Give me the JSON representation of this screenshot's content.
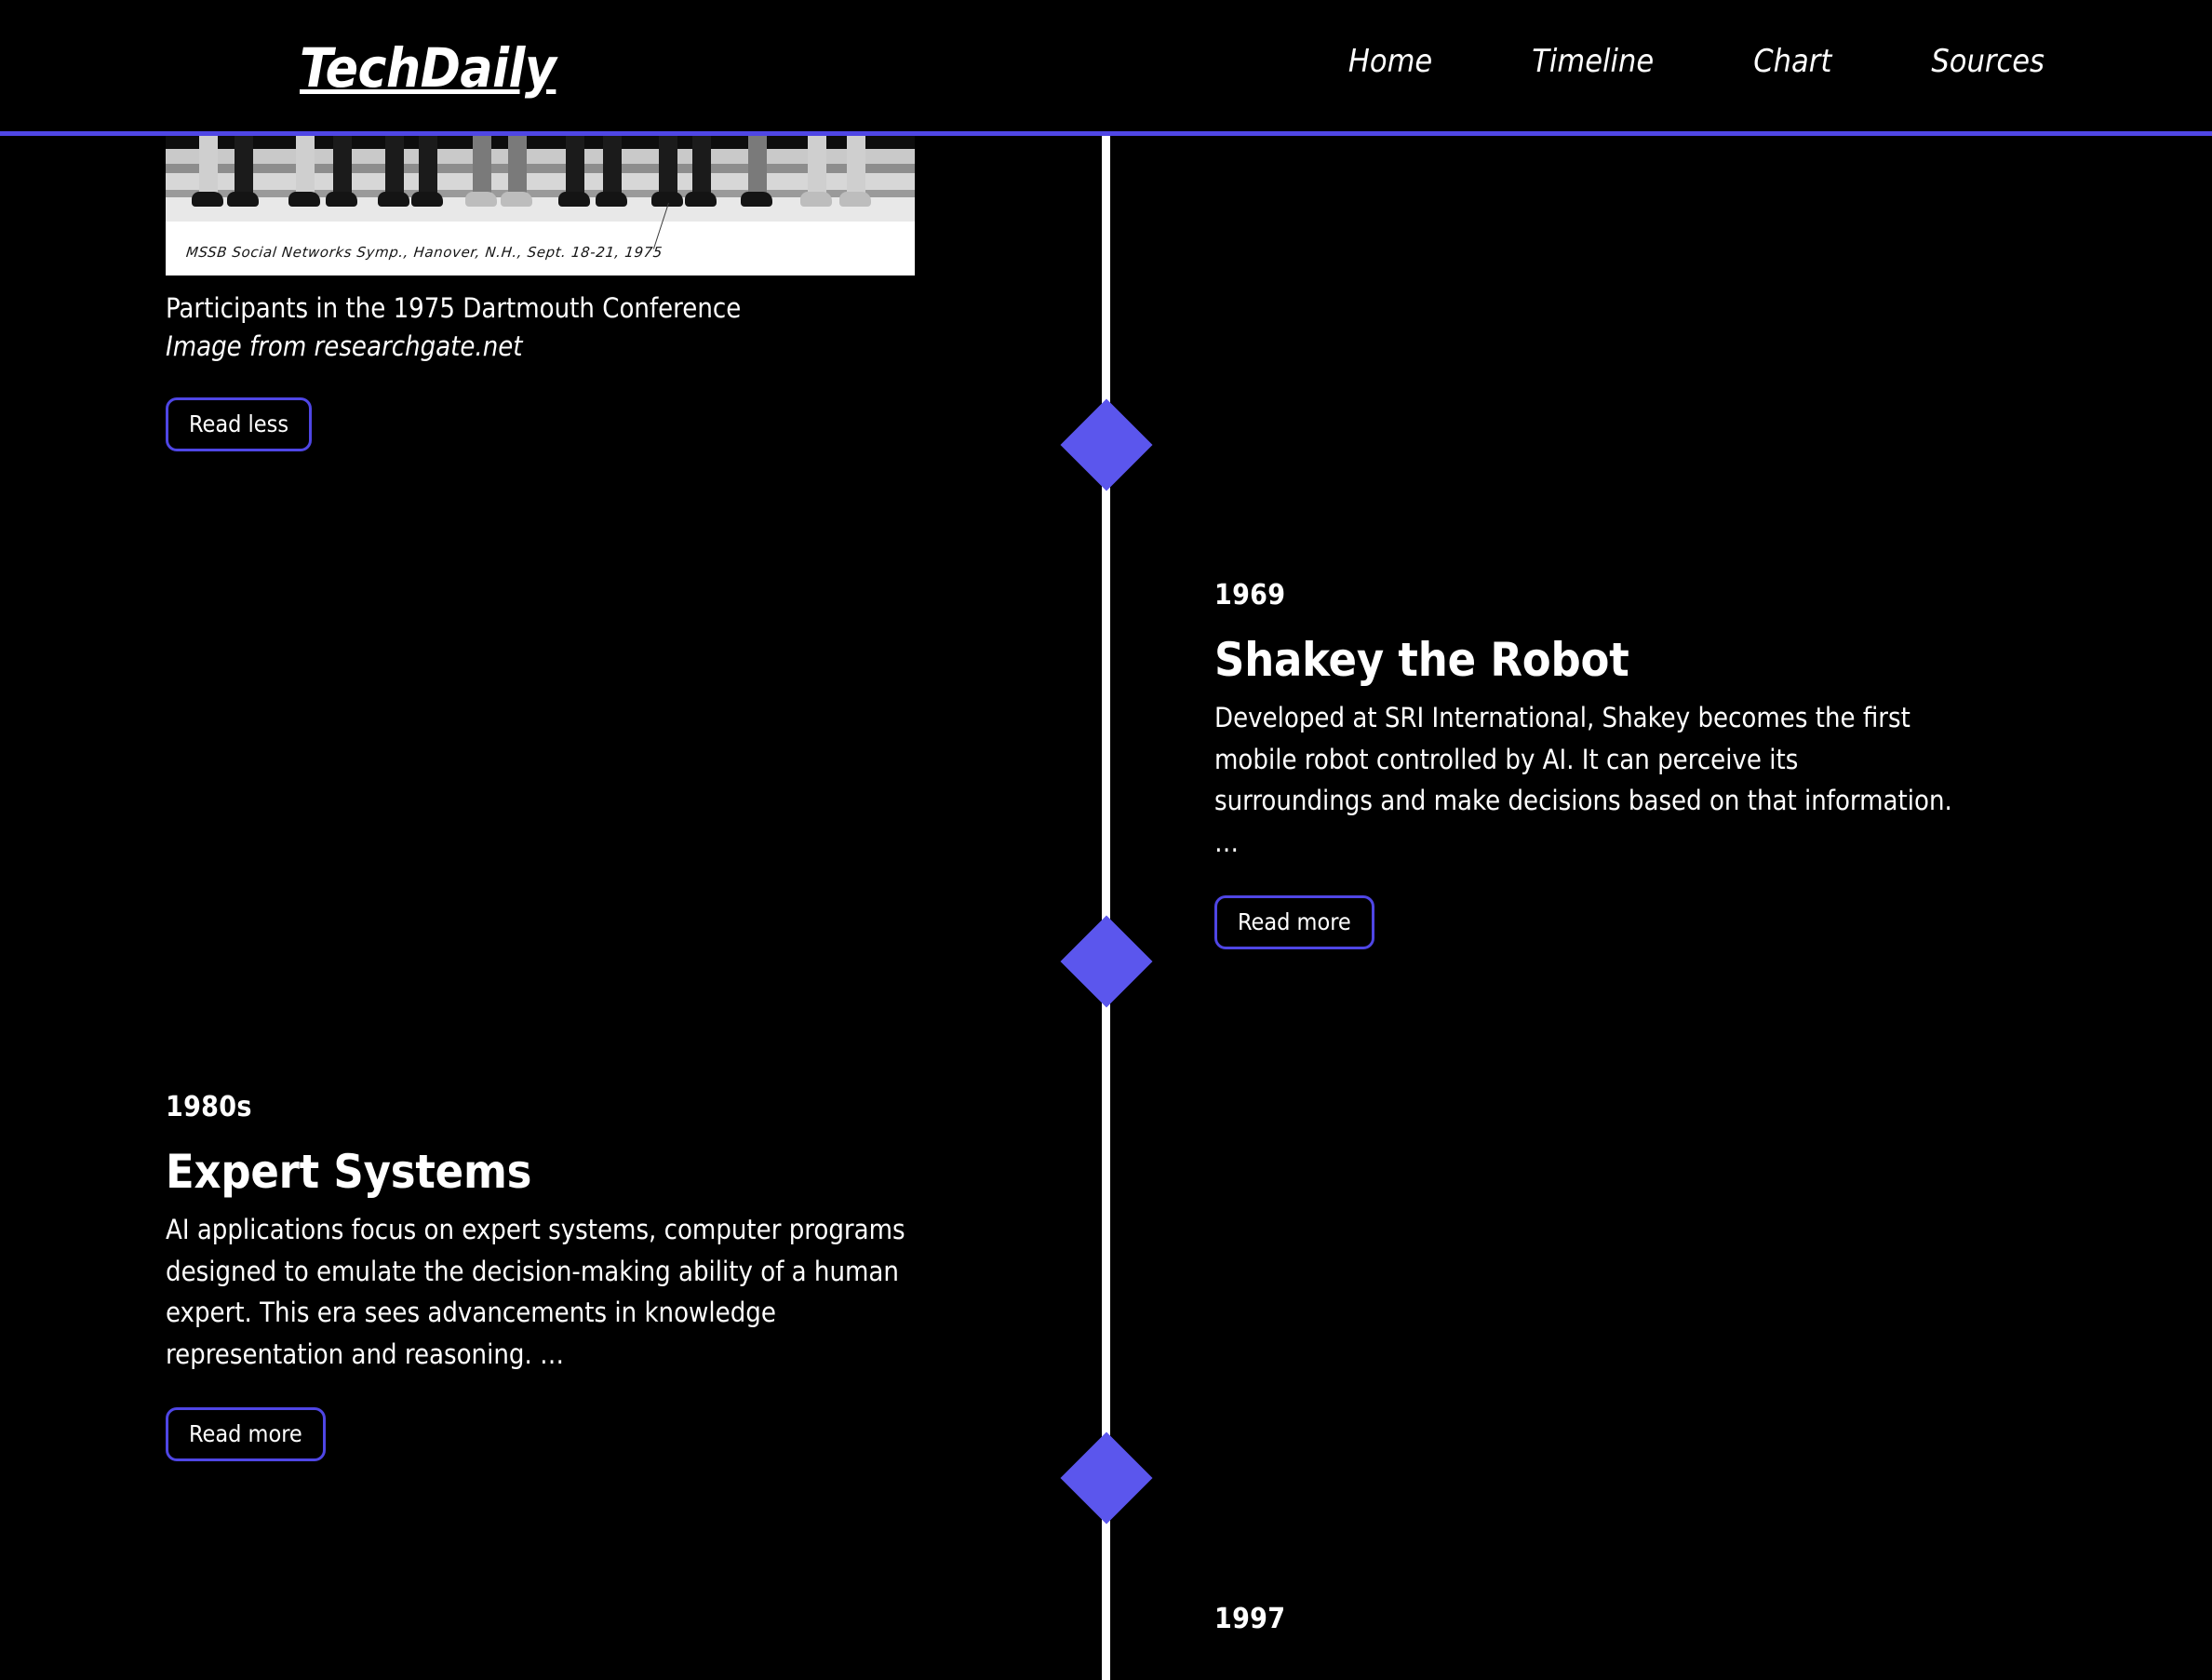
{
  "header": {
    "brand": "TechDaily",
    "nav": [
      {
        "label": "Home",
        "name": "nav-link-home"
      },
      {
        "label": "Timeline",
        "name": "nav-link-timeline"
      },
      {
        "label": "Chart",
        "name": "nav-link-chart"
      },
      {
        "label": "Sources",
        "name": "nav-link-sources"
      }
    ]
  },
  "colors": {
    "background": "#000000",
    "accent": "#4f46e5",
    "marker": "#5b56ed",
    "spine": "#ffffff",
    "text": "#ffffff"
  },
  "media": {
    "photo_handwriting": "MSSB Social Networks Symp., Hanover, N.H., Sept. 18-21, 1975",
    "caption": "Participants in the 1975 Dartmouth Conference",
    "credit": "Image from researchgate.net",
    "read_less_label": "Read less"
  },
  "entries": [
    {
      "year": "1969",
      "title": "Shakey the Robot",
      "body": "Developed at SRI International, Shakey becomes the first mobile robot controlled by AI. It can perceive its surroundings and make decisions based on that information. …",
      "button_label": "Read more",
      "side": "right"
    },
    {
      "year": "1980s",
      "title": "Expert Systems",
      "body": "AI applications focus on expert systems, computer programs designed to emulate the decision-making ability of a human expert. This era sees advancements in knowledge representation and reasoning. …",
      "button_label": "Read more",
      "side": "left"
    },
    {
      "year": "1997",
      "title": "",
      "body": "",
      "button_label": "",
      "side": "right"
    }
  ]
}
